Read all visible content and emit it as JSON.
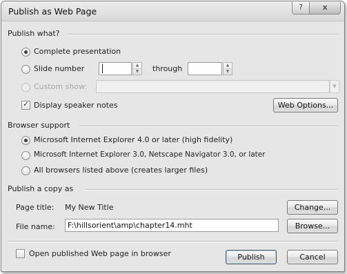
{
  "dialog": {
    "title": "Publish as Web Page",
    "help_glyph": "?",
    "close_glyph": "x"
  },
  "publish_what": {
    "title": "Publish what?",
    "complete_presentation": "Complete presentation",
    "slide_number": "Slide number",
    "through": "through",
    "slide_from_value": "",
    "slide_to_value": "",
    "custom_show": "Custom show:",
    "custom_show_value": "",
    "display_speaker_notes": "Display speaker notes",
    "speaker_notes_checked": true,
    "web_options_button": "Web Options..."
  },
  "browser_support": {
    "title": "Browser support",
    "option_ie4": "Microsoft Internet Explorer 4.0 or later (high fidelity)",
    "option_ie3": "Microsoft Internet Explorer 3.0, Netscape Navigator 3.0, or later",
    "option_all": "All browsers listed above (creates larger files)",
    "selected": "option_ie4"
  },
  "publish_copy": {
    "title": "Publish a copy as",
    "page_title_label": "Page title:",
    "page_title_value": "My New Title",
    "change_button": "Change...",
    "file_name_label": "File name:",
    "file_name_value": "F:\\hillsorient\\amp\\chapter14.mht",
    "browse_button": "Browse..."
  },
  "footer": {
    "open_in_browser": "Open published Web page in browser",
    "open_in_browser_checked": false,
    "publish_button": "Publish",
    "cancel_button": "Cancel"
  },
  "icons": {
    "check_glyph": "✓",
    "spin_up": "▲",
    "spin_down": "▼",
    "dropdown": "▼"
  }
}
